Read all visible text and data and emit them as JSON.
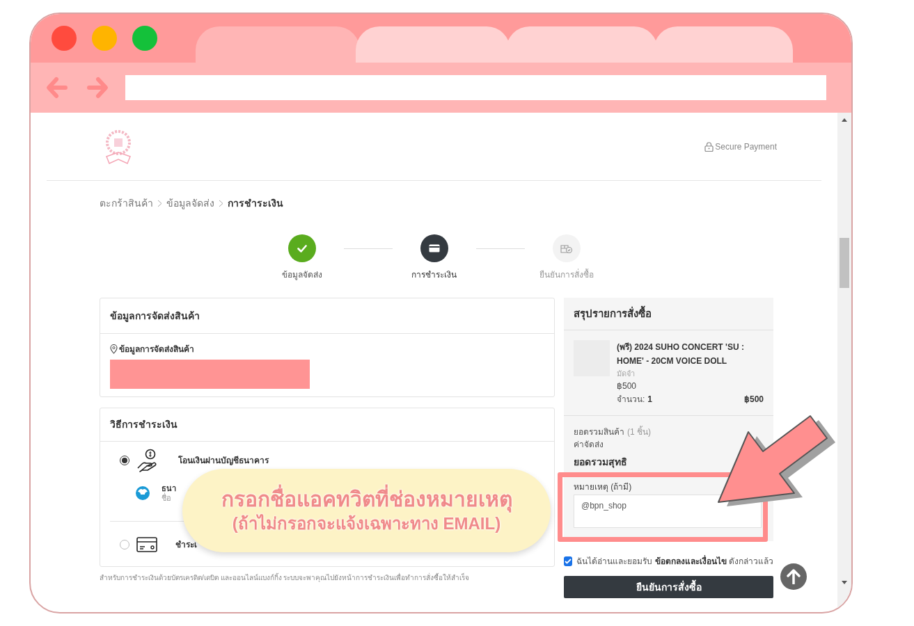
{
  "browser": {
    "tabs": [
      {
        "selected": true
      },
      {
        "selected": false
      },
      {
        "selected": false
      },
      {
        "selected": false
      }
    ]
  },
  "header": {
    "secure_label": "Secure Payment"
  },
  "breadcrumb": [
    {
      "label": "ตะกร้าสินค้า",
      "current": false
    },
    {
      "label": "ข้อมูลจัดส่ง",
      "current": false
    },
    {
      "label": "การชำระเงิน",
      "current": true
    }
  ],
  "steps": [
    {
      "label": "ข้อมูลจัดส่ง",
      "completed": true,
      "active": false
    },
    {
      "label": "การชำระเงิน",
      "completed": false,
      "active": true
    },
    {
      "label": "ยืนยันการสั่งซื้อ",
      "completed": false,
      "active": false
    }
  ],
  "shipping_card": {
    "title": "ข้อมูลการจัดส่งสินค้า",
    "address_label": "ข้อมูลการจัดส่งสินค้า"
  },
  "payment_card": {
    "title": "วิธีการชำระเงิน",
    "methods": [
      {
        "kind": "bank",
        "label": "โอนเงินผ่านบัญชีธนาคาร",
        "selected": true,
        "bank_name": "ธนา",
        "bank_detail": "ชื่อ"
      },
      {
        "kind": "card",
        "label": "ชำระเ",
        "selected": false
      }
    ]
  },
  "footnote": "สำหรับการชำระเงินด้วยบัตรเครดิต/เดบิต และออนไลน์แบงก์กิ้ง ระบบจะพาคุณไปยังหน้าการชำระเงินเพื่อทำการสั่งซื้อให้สำเร็จ",
  "summary": {
    "title": "สรุปรายการสั่งซื้อ",
    "items": [
      {
        "name": "(พรี) 2024 SUHO CONCERT 'SU : HOME' - 20CM VOICE DOLL",
        "option": "มัดจำ",
        "price": "฿500",
        "qty_label": "จำนวน:",
        "qty": "1",
        "total": "฿500"
      }
    ],
    "subtotal_label": "ยอดรวมสินค้า",
    "subtotal_count": "(1 ชิ้น)",
    "shipping_label": "ค่าจัดส่ง",
    "net_label": "ยอดรวมสุทธิ",
    "note": {
      "label": "หมายเหตุ (ถ้ามี)",
      "value": "@bpn_shop"
    },
    "agree": {
      "checked": true,
      "before": "ฉันได้อ่านและยอมรับ",
      "link": "ข้อตกลงและเงื่อนไข",
      "after": "ดังกล่าวแล้ว"
    },
    "confirm_button": "ยืนยันการสั่งซื้อ"
  },
  "annotation": {
    "line1": "กรอกชื่อแอคทวิตที่ช่องหมายเหตุ",
    "line2": "(ถ้าไม่กรอกจะแจ้งเฉพาะทาง EMAIL)"
  }
}
